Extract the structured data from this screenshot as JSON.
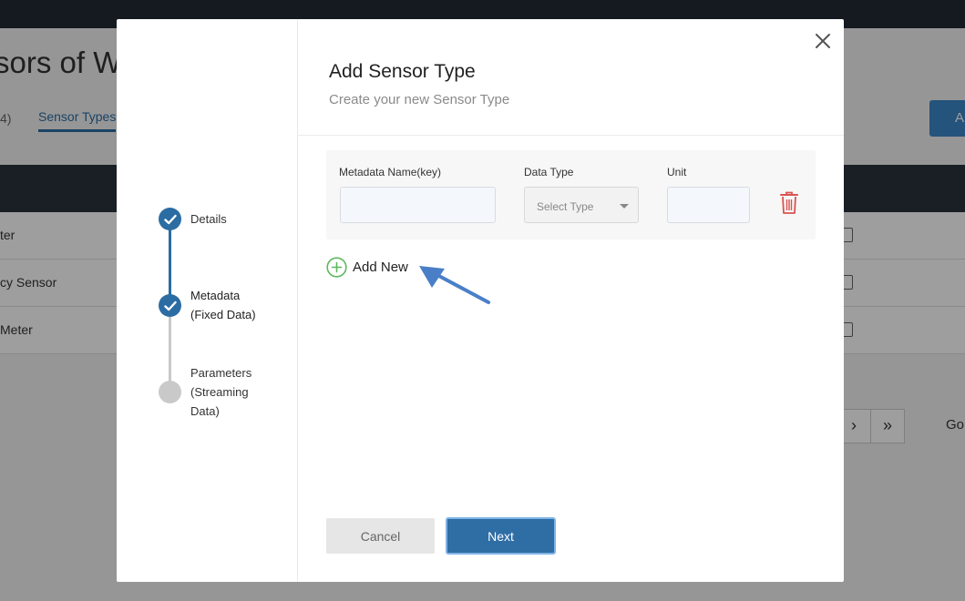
{
  "background": {
    "page_title": "sors of W",
    "tab_count": "4)",
    "tab_active": "Sensor Types",
    "add_button": "A",
    "rows": [
      "ter",
      "cy Sensor",
      "Meter"
    ],
    "pager_next": "›",
    "pager_last": "»",
    "go_label": "Go"
  },
  "modal": {
    "title": "Add Sensor Type",
    "subtitle": "Create your new Sensor Type",
    "steps": [
      {
        "label_line1": "Details",
        "status": "done"
      },
      {
        "label_line1": "Metadata",
        "label_line2": "(Fixed Data)",
        "status": "done"
      },
      {
        "label_line1": "Parameters",
        "label_line2": "(Streaming",
        "label_line3": "Data)",
        "status": "todo"
      }
    ],
    "metadata": {
      "name_label": "Metadata Name(key)",
      "name_value": "",
      "type_label": "Data Type",
      "type_placeholder": "Select Type",
      "unit_label": "Unit",
      "unit_value": ""
    },
    "add_new_label": "Add New",
    "cancel_label": "Cancel",
    "next_label": "Next"
  },
  "colors": {
    "primary": "#2f6da5",
    "step_done": "#2b6ca3",
    "step_todo": "#c9c9c9",
    "delete": "#d9534f",
    "add": "#5cb85c",
    "annotation_arrow": "#4a7fc8"
  },
  "icons": {
    "close": "close-icon",
    "delete": "trash-icon",
    "add": "plus-circle-icon",
    "step_done": "check-icon"
  }
}
